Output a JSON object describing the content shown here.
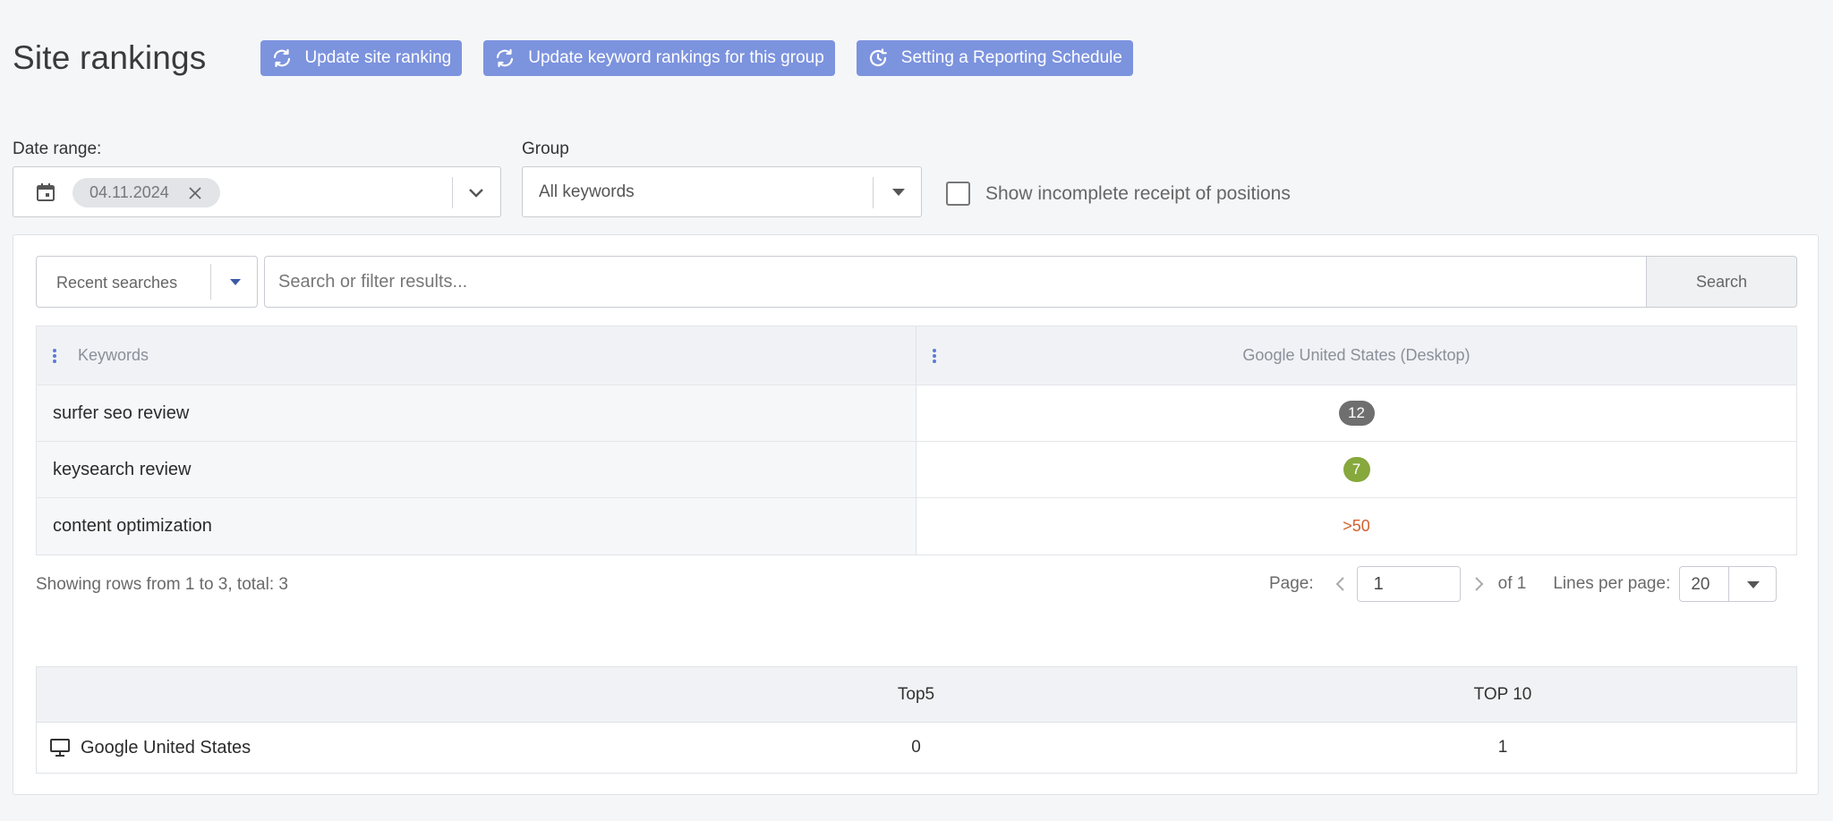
{
  "header": {
    "title": "Site rankings",
    "buttons": [
      {
        "label": "Update site ranking",
        "icon": "refresh-icon"
      },
      {
        "label": "Update keyword rankings for this group",
        "icon": "refresh-icon"
      },
      {
        "label": "Setting a Reporting Schedule",
        "icon": "schedule-icon"
      }
    ]
  },
  "filters": {
    "date_label": "Date range:",
    "date_value": "04.11.2024",
    "group_label": "Group",
    "group_value": "All keywords",
    "checkbox_label": "Show incomplete receipt of positions",
    "checkbox_checked": false
  },
  "search": {
    "recent_label": "Recent searches",
    "placeholder": "Search or filter results...",
    "button_label": "Search"
  },
  "table": {
    "columns": [
      "Keywords",
      "Google United States (Desktop)"
    ],
    "rows": [
      {
        "keyword": "surfer seo review",
        "position": "12",
        "style": "gray"
      },
      {
        "keyword": "keysearch review",
        "position": "7",
        "style": "green"
      },
      {
        "keyword": "content optimization",
        "position": ">50",
        "style": "text"
      }
    ]
  },
  "pagination": {
    "showing": "Showing rows from 1 to 3, total: 3",
    "page_label": "Page:",
    "page_value": "1",
    "of_label": "of 1",
    "lines_label": "Lines per page:",
    "lines_value": "20"
  },
  "summary": {
    "columns": [
      "",
      "Top5",
      "TOP 10"
    ],
    "rows": [
      {
        "engine": "Google United States",
        "top5": "0",
        "top10": "1",
        "icon": "desktop-icon"
      }
    ]
  },
  "colors": {
    "accent": "#7c93de",
    "badge_gray": "#6f6f6f",
    "badge_green": "#86a83c",
    "position_out": "#d0612e"
  }
}
